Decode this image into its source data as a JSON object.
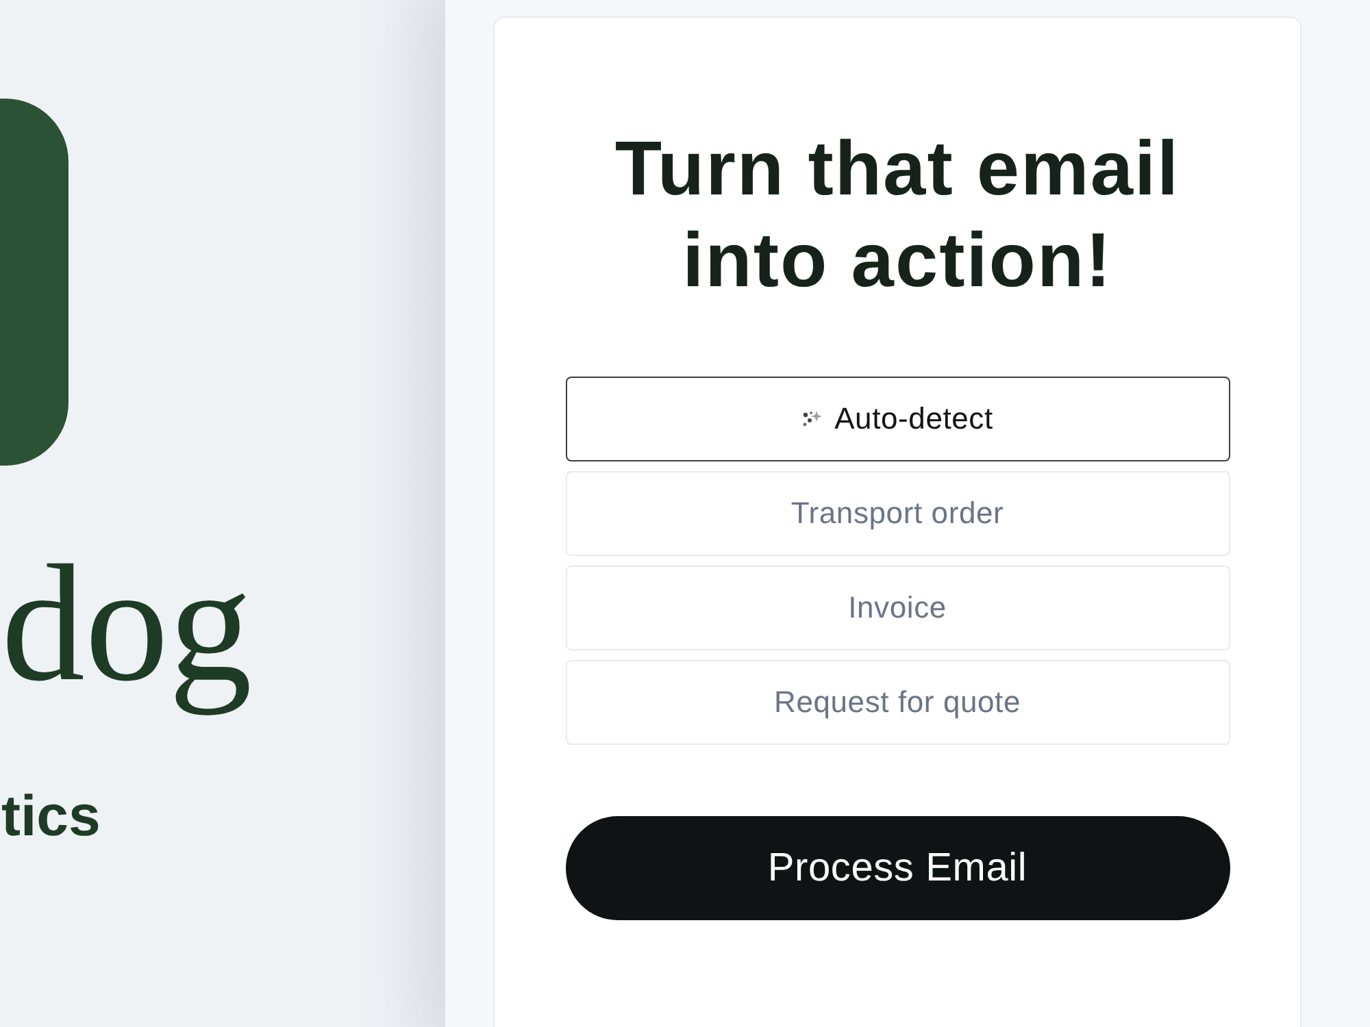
{
  "brand": {
    "logo_text": "dog",
    "tagline": "tics"
  },
  "card": {
    "heading": "Turn that email into action!",
    "options": [
      {
        "kind": "auto",
        "label": "Auto-detect",
        "selected": true
      },
      {
        "kind": "plain",
        "label": "Transport order",
        "selected": false
      },
      {
        "kind": "plain",
        "label": "Invoice",
        "selected": false
      },
      {
        "kind": "plain",
        "label": "Request for quote",
        "selected": false
      }
    ],
    "submit_button": "Process Email"
  }
}
